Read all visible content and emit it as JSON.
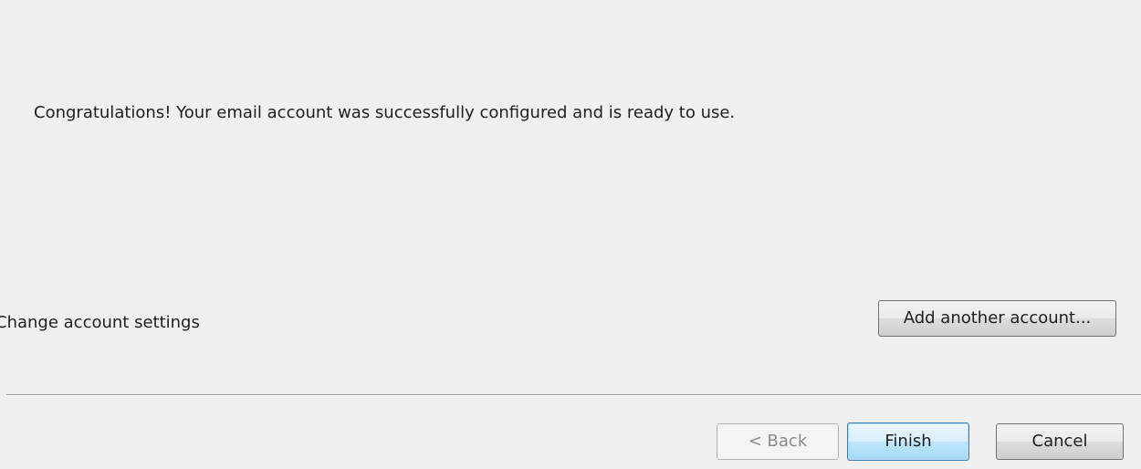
{
  "wizard": {
    "success_message": "Congratulations! Your email account was successfully configured and is ready to use.",
    "change_settings_label": "Change account settings",
    "add_account_label": "Add another account...",
    "back_label": "< Back",
    "finish_label": "Finish",
    "cancel_label": "Cancel"
  }
}
